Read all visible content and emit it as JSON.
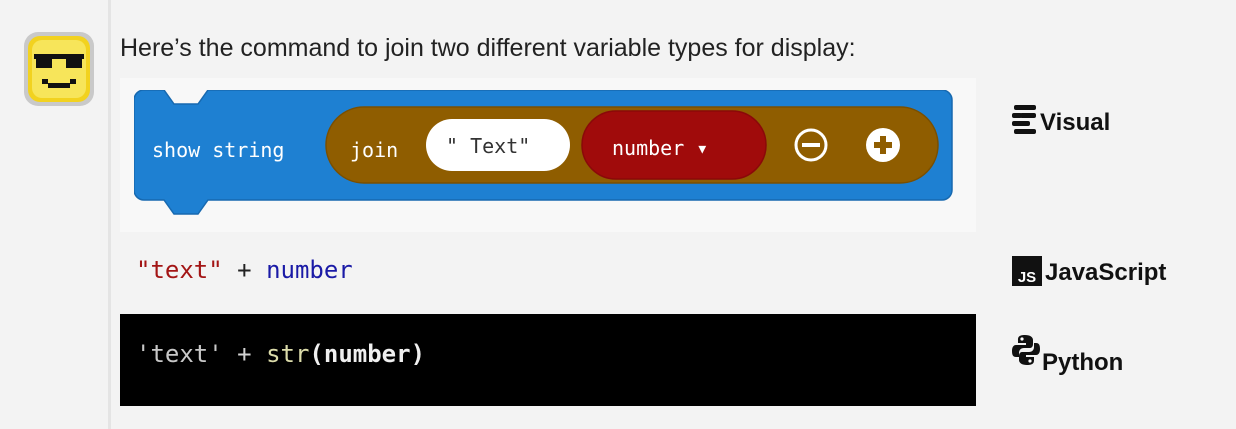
{
  "intro_text": "Here’s the command to join two different variable types for display:",
  "blocks": {
    "show_string": "show string",
    "join": "join",
    "text_value": "\" Text\"",
    "number_dropdown": "number ▾"
  },
  "javascript": {
    "string": "\"text\"",
    "operator": " + ",
    "identifier": "number"
  },
  "python": {
    "string": "'text'",
    "operator": " + ",
    "function": "str",
    "open_paren": "(",
    "argument": "number",
    "close_paren": ")"
  },
  "labels": {
    "visual": "Visual",
    "js_badge": "JS",
    "javascript": "JavaScript",
    "python": "Python"
  },
  "colors": {
    "block_blue": "#1e80d2",
    "block_brown": "#8f5d00",
    "block_red": "#a00b0b",
    "python_bg": "#000000"
  },
  "icons": {
    "avatar": "sunglasses-smiley-icon",
    "visual": "blocks-icon",
    "javascript": "js-icon",
    "python": "python-icon",
    "remove": "minus-circle-icon",
    "add": "plus-circle-icon"
  }
}
